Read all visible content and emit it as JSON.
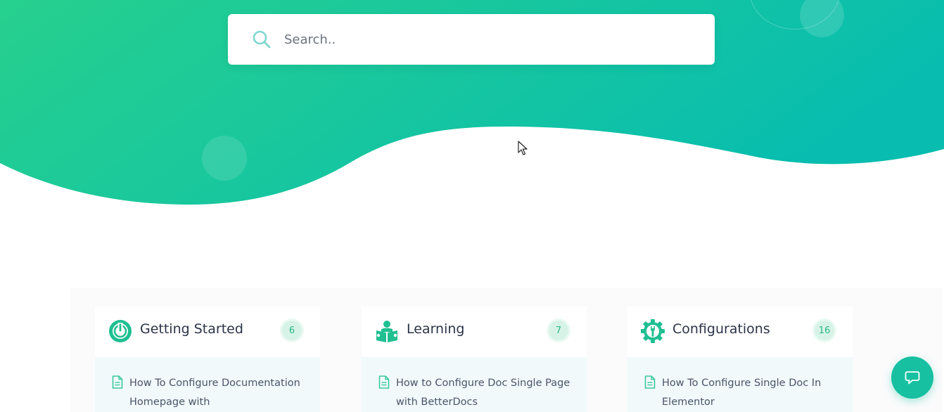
{
  "hero": {
    "gradient_start": "#27d08e",
    "gradient_end": "#08bdaf"
  },
  "search": {
    "placeholder": "Search..",
    "value": "",
    "icon": "search-icon"
  },
  "categories": [
    {
      "title": "Getting Started",
      "count": "6",
      "icon": "power-icon",
      "docs": [
        {
          "title": "How To Configure Documentation Homepage with"
        }
      ]
    },
    {
      "title": "Learning",
      "count": "7",
      "icon": "reading-person-icon",
      "docs": [
        {
          "title": "How to Configure Doc Single Page with BetterDocs"
        }
      ]
    },
    {
      "title": "Configurations",
      "count": "16",
      "icon": "gear-wrench-icon",
      "docs": [
        {
          "title": "How To Configure Single Doc In Elementor"
        }
      ]
    }
  ],
  "chat": {
    "icon": "chat-bubble-icon"
  },
  "colors": {
    "accent": "#16c0a0",
    "title_text": "#2b3348",
    "doc_text": "#4a5568",
    "badge_bg": "#d7f3e8",
    "badge_text": "#2ab58a"
  }
}
